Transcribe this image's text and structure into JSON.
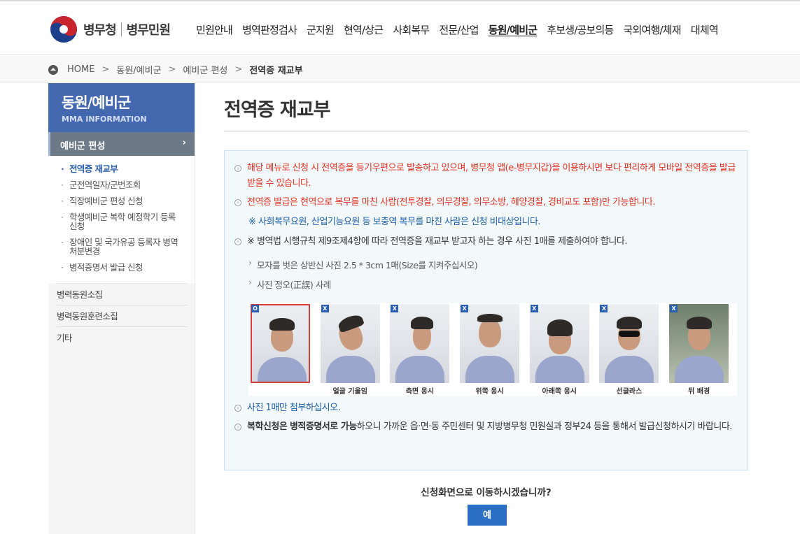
{
  "header": {
    "logo_text": "병무청",
    "logo_sub": "병무민원",
    "nav": [
      "민원안내",
      "병역판정검사",
      "군지원",
      "현역/상근",
      "사회복무",
      "전문/산업",
      "동원/예비군",
      "후보생/공보의등",
      "국외여행/체재",
      "대체역"
    ],
    "active_nav": "동원/예비군"
  },
  "breadcrumb": {
    "home": "HOME",
    "items": [
      "동원/예비군",
      "예비군 편성"
    ],
    "current": "전역증 재교부",
    "sep": ">"
  },
  "sidebar": {
    "title": "동원/예비군",
    "subtitle": "MMA INFORMATION",
    "current_section": "예비군 편성",
    "chevron": "›",
    "sub_items": [
      "전역증 재교부",
      "군전역일자/군번조회",
      "직장예비군 편성 신청",
      "학생예비군 복학 예정학기 등록 신청",
      "장애인 및 국가유공 등록자 병역처분변경",
      "병적증명서 발급 신청"
    ],
    "active_sub": "전역증 재교부",
    "menus": [
      "병력동원소집",
      "병력동원훈련소집",
      "기타"
    ]
  },
  "main": {
    "title": "전역증 재교부",
    "notice": {
      "item1": "해당 메뉴로 신청 시 전역증을 등기우편으로 발송하고 있으며, 병무청 앱(e-병무지갑)을 이용하시면 보다 편리하게 모바일 전역증을 발급 받을 수 있습니다.",
      "item2": "전역증 발급은 현역으로 복무를 마친 사람(전투경찰, 의무경찰, 의무소방, 해양경찰, 경비교도 포함)만 가능합니다.",
      "item2_note": "※ 사회복무요원, 산업기능요원 등 보충역 복무를 마친 사람은 신청 비대상입니다.",
      "item3": "※ 병역법 시행규칙 제9조제4항에 따라 전역증을 재교부 받고자 하는 경우 사진 1매를 제출하여야 합니다.",
      "sub1": "모자를 벗은 상반신 사진 2.5 * 3cm 1매(Size를 지켜주십시오)",
      "sub2": "사진 정오(正誤) 사례",
      "item4": "사진 1매만 첨부하십시오.",
      "item5_bold1": "복학신청은",
      "item5_bold2": "병적증명서로 가능",
      "item5_text1": " ",
      "item5_text2": "하오니 가까운 읍·면·동 주민센터 및 지방병무청 민원실과 정부24 등을 통해서 발급신청하시기 바랍니다.",
      "bullet": "›"
    },
    "photos": [
      {
        "mark": "O",
        "caption": ""
      },
      {
        "mark": "X",
        "caption": "얼굴 기울임"
      },
      {
        "mark": "X",
        "caption": "측면 응시"
      },
      {
        "mark": "X",
        "caption": "위쪽 응시"
      },
      {
        "mark": "X",
        "caption": "아래쪽 응시"
      },
      {
        "mark": "X",
        "caption": "선글라스"
      },
      {
        "mark": "X",
        "caption": "뒤 배경"
      }
    ],
    "question": "신청화면으로 이동하시겠습니까?",
    "yes_button": "예"
  },
  "colors": {
    "accent_blue": "#4468b0",
    "notice_red": "#e03121",
    "notice_blue": "#1b5ea9",
    "button_blue": "#2b6fc4"
  }
}
